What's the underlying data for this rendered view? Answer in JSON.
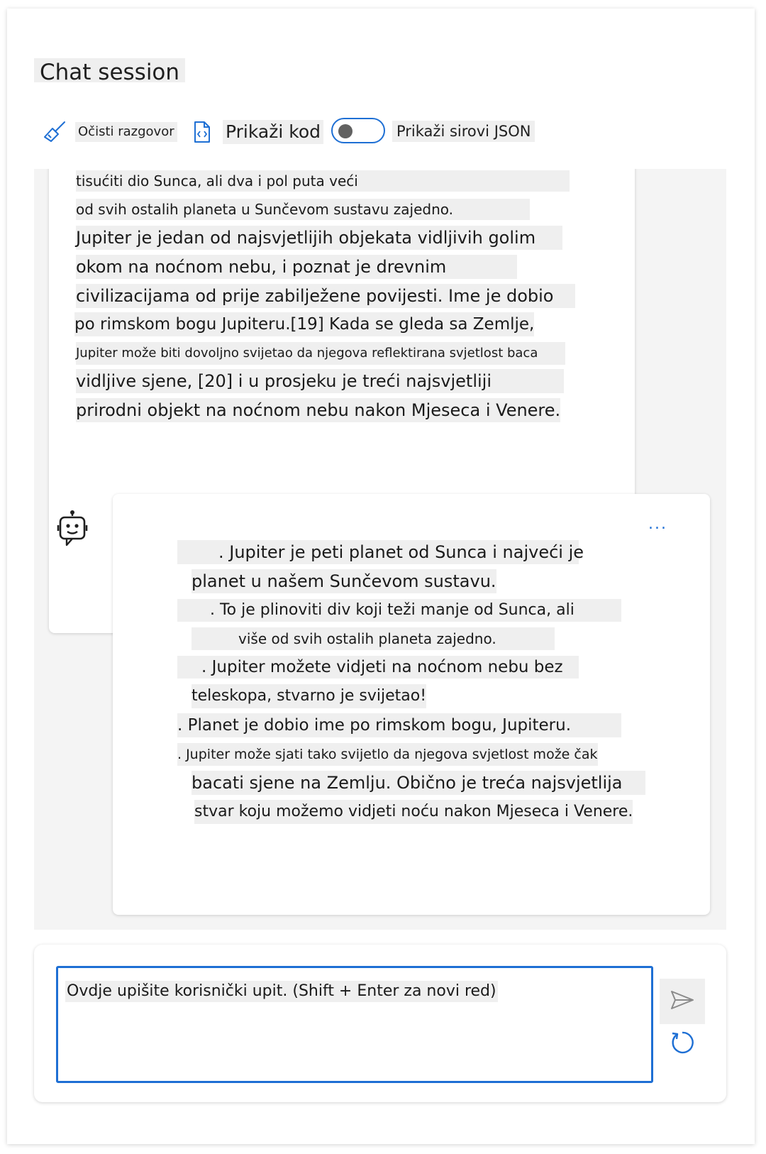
{
  "header": {
    "title": "Chat session"
  },
  "toolbar": {
    "clear_label": "Očisti razgovor",
    "code_label": "Prikaži kod",
    "json_label": "Prikaži sirovi JSON",
    "json_toggle_on": false
  },
  "user_message": {
    "lines": [
      "tisućiti dio Sunca, ali dva i pol puta veći",
      "od svih ostalih planeta u Sunčevom sustavu zajedno.",
      "Jupiter je jedan od najsvjetlijih objekata vidljivih golim",
      "okom na noćnom nebu, i poznat je drevnim",
      "civilizacijama od prije zabilježene povijesti. Ime je dobio",
      "po rimskom bogu Jupiteru.[19] Kada se gleda sa Zemlje,",
      "Jupiter može biti dovoljno svijetao da njegova reflektirana svjetlost baca",
      "vidljive sjene, [20] i u prosjeku je treći najsvjetliji",
      "prirodni objekt na noćnom nebu nakon Mjeseca i Venere."
    ]
  },
  "bot_message": {
    "more_label": "...",
    "lines": [
      ". Jupiter je peti planet od Sunca i najveći je",
      "planet u našem Sunčevom sustavu.",
      ". To je plinoviti div koji teži manje od Sunca, ali",
      "više od svih ostalih planeta zajedno.",
      ". Jupiter možete vidjeti na noćnom nebu bez",
      "teleskopa, stvarno je svijetao!",
      ". Planet je dobio ime po rimskom bogu, Jupiteru.",
      ". Jupiter može sjati tako svijetlo da njegova svjetlost može čak",
      "bacati sjene na Zemlju. Obično je treća najsvjetlija",
      "stvar koju možemo vidjeti noću nakon Mjeseca i Venere."
    ]
  },
  "input": {
    "placeholder": "Ovdje upišite korisnički upit. (Shift + Enter za novi red)"
  },
  "icons": {
    "clear": "broom-icon",
    "code": "code-file-icon",
    "bot": "bot-icon",
    "send": "send-icon",
    "refresh": "refresh-icon"
  },
  "colors": {
    "accent": "#1e6fd4",
    "chat_background": "#f4f4f4"
  }
}
